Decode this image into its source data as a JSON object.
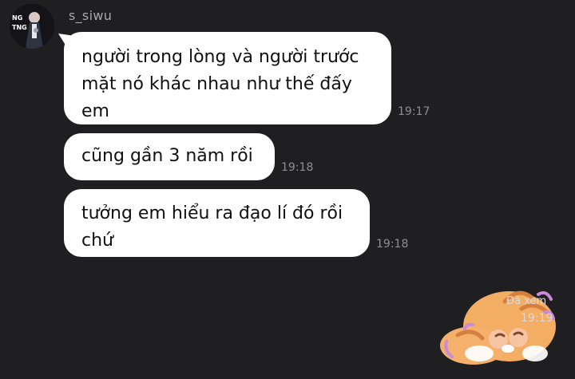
{
  "header": {
    "sender_name": "s_siwu"
  },
  "avatar_text": "NG TNG",
  "messages": [
    {
      "lines": [
        "người trong lòng và người trước",
        "mặt nó khác nhau như thế đấy",
        "em"
      ],
      "time": "19:17"
    },
    {
      "lines": [
        "cũng gần 3 năm rồi"
      ],
      "time": "19:18"
    },
    {
      "lines": [
        "tưởng em hiểu ra đạo lí đó rồi",
        "chứ"
      ],
      "time": "19:18"
    }
  ],
  "sent_sticker": {
    "icon": "sleeping-tiger-cat-sticker-icon",
    "status": "Đã xem",
    "time": "19:19"
  },
  "colors": {
    "background": "#1f1f21",
    "bubble": "#ffffff",
    "meta": "#8e8e93"
  }
}
